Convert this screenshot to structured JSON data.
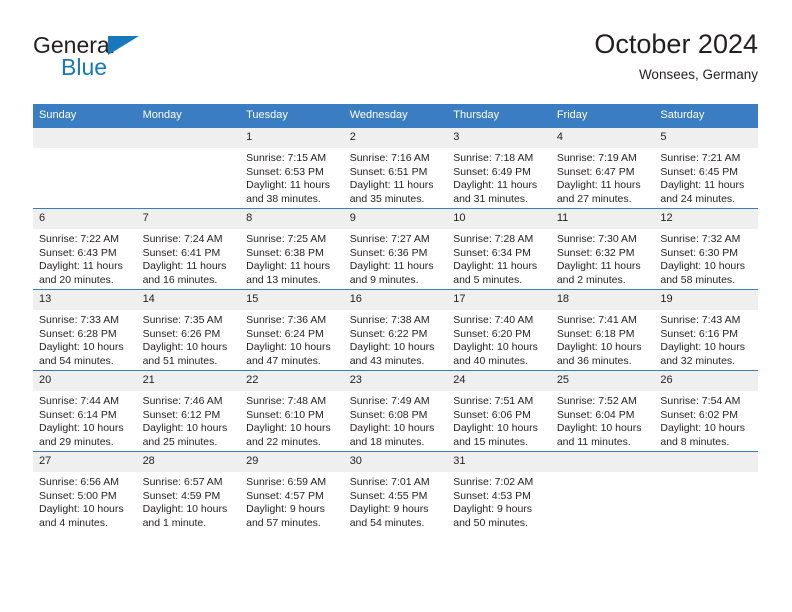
{
  "brand": {
    "name_part1": "General",
    "name_part2": "Blue",
    "triangle_icon": "triangle-icon",
    "accent_color": "#1878be"
  },
  "header": {
    "title": "October 2024",
    "subtitle": "Wonsees, Germany"
  },
  "theme": {
    "header_blue": "#3b7dc3",
    "daynum_band": "#efefef",
    "text": "#231f20"
  },
  "calendar": {
    "weekday_headers": [
      "Sunday",
      "Monday",
      "Tuesday",
      "Wednesday",
      "Thursday",
      "Friday",
      "Saturday"
    ],
    "weeks": [
      [
        {
          "day": "",
          "empty": true,
          "sunrise": "",
          "sunset": "",
          "daylight_line1": "",
          "daylight_line2": ""
        },
        {
          "day": "",
          "empty": true,
          "sunrise": "",
          "sunset": "",
          "daylight_line1": "",
          "daylight_line2": ""
        },
        {
          "day": "1",
          "sunrise": "Sunrise: 7:15 AM",
          "sunset": "Sunset: 6:53 PM",
          "daylight_line1": "Daylight: 11 hours",
          "daylight_line2": "and 38 minutes."
        },
        {
          "day": "2",
          "sunrise": "Sunrise: 7:16 AM",
          "sunset": "Sunset: 6:51 PM",
          "daylight_line1": "Daylight: 11 hours",
          "daylight_line2": "and 35 minutes."
        },
        {
          "day": "3",
          "sunrise": "Sunrise: 7:18 AM",
          "sunset": "Sunset: 6:49 PM",
          "daylight_line1": "Daylight: 11 hours",
          "daylight_line2": "and 31 minutes."
        },
        {
          "day": "4",
          "sunrise": "Sunrise: 7:19 AM",
          "sunset": "Sunset: 6:47 PM",
          "daylight_line1": "Daylight: 11 hours",
          "daylight_line2": "and 27 minutes."
        },
        {
          "day": "5",
          "sunrise": "Sunrise: 7:21 AM",
          "sunset": "Sunset: 6:45 PM",
          "daylight_line1": "Daylight: 11 hours",
          "daylight_line2": "and 24 minutes."
        }
      ],
      [
        {
          "day": "6",
          "sunrise": "Sunrise: 7:22 AM",
          "sunset": "Sunset: 6:43 PM",
          "daylight_line1": "Daylight: 11 hours",
          "daylight_line2": "and 20 minutes."
        },
        {
          "day": "7",
          "sunrise": "Sunrise: 7:24 AM",
          "sunset": "Sunset: 6:41 PM",
          "daylight_line1": "Daylight: 11 hours",
          "daylight_line2": "and 16 minutes."
        },
        {
          "day": "8",
          "sunrise": "Sunrise: 7:25 AM",
          "sunset": "Sunset: 6:38 PM",
          "daylight_line1": "Daylight: 11 hours",
          "daylight_line2": "and 13 minutes."
        },
        {
          "day": "9",
          "sunrise": "Sunrise: 7:27 AM",
          "sunset": "Sunset: 6:36 PM",
          "daylight_line1": "Daylight: 11 hours",
          "daylight_line2": "and 9 minutes."
        },
        {
          "day": "10",
          "sunrise": "Sunrise: 7:28 AM",
          "sunset": "Sunset: 6:34 PM",
          "daylight_line1": "Daylight: 11 hours",
          "daylight_line2": "and 5 minutes."
        },
        {
          "day": "11",
          "sunrise": "Sunrise: 7:30 AM",
          "sunset": "Sunset: 6:32 PM",
          "daylight_line1": "Daylight: 11 hours",
          "daylight_line2": "and 2 minutes."
        },
        {
          "day": "12",
          "sunrise": "Sunrise: 7:32 AM",
          "sunset": "Sunset: 6:30 PM",
          "daylight_line1": "Daylight: 10 hours",
          "daylight_line2": "and 58 minutes."
        }
      ],
      [
        {
          "day": "13",
          "sunrise": "Sunrise: 7:33 AM",
          "sunset": "Sunset: 6:28 PM",
          "daylight_line1": "Daylight: 10 hours",
          "daylight_line2": "and 54 minutes."
        },
        {
          "day": "14",
          "sunrise": "Sunrise: 7:35 AM",
          "sunset": "Sunset: 6:26 PM",
          "daylight_line1": "Daylight: 10 hours",
          "daylight_line2": "and 51 minutes."
        },
        {
          "day": "15",
          "sunrise": "Sunrise: 7:36 AM",
          "sunset": "Sunset: 6:24 PM",
          "daylight_line1": "Daylight: 10 hours",
          "daylight_line2": "and 47 minutes."
        },
        {
          "day": "16",
          "sunrise": "Sunrise: 7:38 AM",
          "sunset": "Sunset: 6:22 PM",
          "daylight_line1": "Daylight: 10 hours",
          "daylight_line2": "and 43 minutes."
        },
        {
          "day": "17",
          "sunrise": "Sunrise: 7:40 AM",
          "sunset": "Sunset: 6:20 PM",
          "daylight_line1": "Daylight: 10 hours",
          "daylight_line2": "and 40 minutes."
        },
        {
          "day": "18",
          "sunrise": "Sunrise: 7:41 AM",
          "sunset": "Sunset: 6:18 PM",
          "daylight_line1": "Daylight: 10 hours",
          "daylight_line2": "and 36 minutes."
        },
        {
          "day": "19",
          "sunrise": "Sunrise: 7:43 AM",
          "sunset": "Sunset: 6:16 PM",
          "daylight_line1": "Daylight: 10 hours",
          "daylight_line2": "and 32 minutes."
        }
      ],
      [
        {
          "day": "20",
          "sunrise": "Sunrise: 7:44 AM",
          "sunset": "Sunset: 6:14 PM",
          "daylight_line1": "Daylight: 10 hours",
          "daylight_line2": "and 29 minutes."
        },
        {
          "day": "21",
          "sunrise": "Sunrise: 7:46 AM",
          "sunset": "Sunset: 6:12 PM",
          "daylight_line1": "Daylight: 10 hours",
          "daylight_line2": "and 25 minutes."
        },
        {
          "day": "22",
          "sunrise": "Sunrise: 7:48 AM",
          "sunset": "Sunset: 6:10 PM",
          "daylight_line1": "Daylight: 10 hours",
          "daylight_line2": "and 22 minutes."
        },
        {
          "day": "23",
          "sunrise": "Sunrise: 7:49 AM",
          "sunset": "Sunset: 6:08 PM",
          "daylight_line1": "Daylight: 10 hours",
          "daylight_line2": "and 18 minutes."
        },
        {
          "day": "24",
          "sunrise": "Sunrise: 7:51 AM",
          "sunset": "Sunset: 6:06 PM",
          "daylight_line1": "Daylight: 10 hours",
          "daylight_line2": "and 15 minutes."
        },
        {
          "day": "25",
          "sunrise": "Sunrise: 7:52 AM",
          "sunset": "Sunset: 6:04 PM",
          "daylight_line1": "Daylight: 10 hours",
          "daylight_line2": "and 11 minutes."
        },
        {
          "day": "26",
          "sunrise": "Sunrise: 7:54 AM",
          "sunset": "Sunset: 6:02 PM",
          "daylight_line1": "Daylight: 10 hours",
          "daylight_line2": "and 8 minutes."
        }
      ],
      [
        {
          "day": "27",
          "sunrise": "Sunrise: 6:56 AM",
          "sunset": "Sunset: 5:00 PM",
          "daylight_line1": "Daylight: 10 hours",
          "daylight_line2": "and 4 minutes."
        },
        {
          "day": "28",
          "sunrise": "Sunrise: 6:57 AM",
          "sunset": "Sunset: 4:59 PM",
          "daylight_line1": "Daylight: 10 hours",
          "daylight_line2": "and 1 minute."
        },
        {
          "day": "29",
          "sunrise": "Sunrise: 6:59 AM",
          "sunset": "Sunset: 4:57 PM",
          "daylight_line1": "Daylight: 9 hours",
          "daylight_line2": "and 57 minutes."
        },
        {
          "day": "30",
          "sunrise": "Sunrise: 7:01 AM",
          "sunset": "Sunset: 4:55 PM",
          "daylight_line1": "Daylight: 9 hours",
          "daylight_line2": "and 54 minutes."
        },
        {
          "day": "31",
          "sunrise": "Sunrise: 7:02 AM",
          "sunset": "Sunset: 4:53 PM",
          "daylight_line1": "Daylight: 9 hours",
          "daylight_line2": "and 50 minutes."
        },
        {
          "day": "",
          "empty": true,
          "sunrise": "",
          "sunset": "",
          "daylight_line1": "",
          "daylight_line2": ""
        },
        {
          "day": "",
          "empty": true,
          "sunrise": "",
          "sunset": "",
          "daylight_line1": "",
          "daylight_line2": ""
        }
      ]
    ]
  }
}
